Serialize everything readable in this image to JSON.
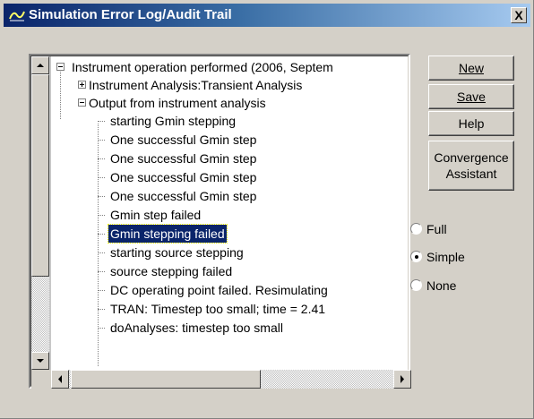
{
  "window": {
    "title": "Simulation Error Log/Audit Trail",
    "close_label": "X"
  },
  "tree": {
    "nodes": [
      {
        "label": "Instrument operation performed   (2006, Septem",
        "level": 0,
        "expander": "minus"
      },
      {
        "label": "Instrument Analysis:Transient Analysis",
        "level": 1,
        "expander": "plus"
      },
      {
        "label": "Output from instrument analysis",
        "level": 1,
        "expander": "minus"
      },
      {
        "label": "starting Gmin stepping",
        "level": 2
      },
      {
        "label": "One successful Gmin step",
        "level": 2
      },
      {
        "label": "One successful Gmin step",
        "level": 2
      },
      {
        "label": "One successful Gmin step",
        "level": 2
      },
      {
        "label": "One successful Gmin step",
        "level": 2
      },
      {
        "label": "Gmin step failed",
        "level": 2
      },
      {
        "label": "Gmin stepping failed",
        "level": 2,
        "selected": true
      },
      {
        "label": "starting source stepping",
        "level": 2
      },
      {
        "label": "source stepping failed",
        "level": 2
      },
      {
        "label": "DC operating point failed. Resimulating",
        "level": 2
      },
      {
        "label": "TRAN:  Timestep too small; time = 2.41",
        "level": 2
      },
      {
        "label": "doAnalyses: timestep too small",
        "level": 2
      }
    ]
  },
  "buttons": {
    "new": "New",
    "save": "Save",
    "help": "Help",
    "convergence_line1": "Convergence",
    "convergence_line2": "Assistant"
  },
  "detail_level": {
    "options": [
      "Full",
      "Simple",
      "None"
    ],
    "selected": "Simple"
  },
  "colors": {
    "title_gradient_start": "#0a246a",
    "selection": "#0a246a",
    "face": "#d4d0c8"
  }
}
